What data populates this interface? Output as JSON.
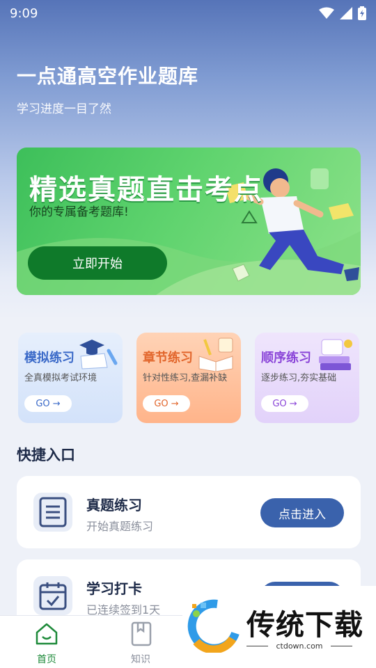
{
  "status": {
    "time": "9:09"
  },
  "header": {
    "title": "一点通高空作业题库",
    "subtitle": "学习进度一目了然"
  },
  "banner": {
    "headline": "精选真题直击考点",
    "subtitle": "你的专属备考题库!",
    "button_label": "立即开始"
  },
  "cards": [
    {
      "title": "模拟练习",
      "desc": "全真模拟考试环境",
      "go": "GO →",
      "color": "#3a69c8",
      "bg": "#dbe8fb",
      "icon": "graduation-cap-icon"
    },
    {
      "title": "章节练习",
      "desc": "针对性练习,查漏补缺",
      "go": "GO →",
      "color": "#e2662c",
      "bg": "#ffd9c2",
      "icon": "open-book-icon"
    },
    {
      "title": "顺序练习",
      "desc": "逐步练习,夯实基础",
      "go": "GO →",
      "color": "#8a45d8",
      "bg": "#ece0fb",
      "icon": "book-stack-icon"
    }
  ],
  "quick": {
    "title": "快捷入口",
    "items": [
      {
        "title": "真题练习",
        "subtitle": "开始真题练习",
        "button": "点击进入",
        "icon": "document-icon"
      },
      {
        "title": "学习打卡",
        "subtitle": "已连续签到1天",
        "button": "",
        "icon": "calendar-check-icon"
      }
    ]
  },
  "tabs": [
    {
      "label": "首页",
      "icon": "home-icon",
      "active": true
    },
    {
      "label": "知识",
      "icon": "book-icon",
      "active": false
    }
  ],
  "watermark": {
    "text": "传统下载",
    "url": "ctdown.com"
  },
  "colors": {
    "primary": "#3a62ac",
    "banner_green": "#3dbf5a",
    "tab_active": "#1e8a3a"
  }
}
